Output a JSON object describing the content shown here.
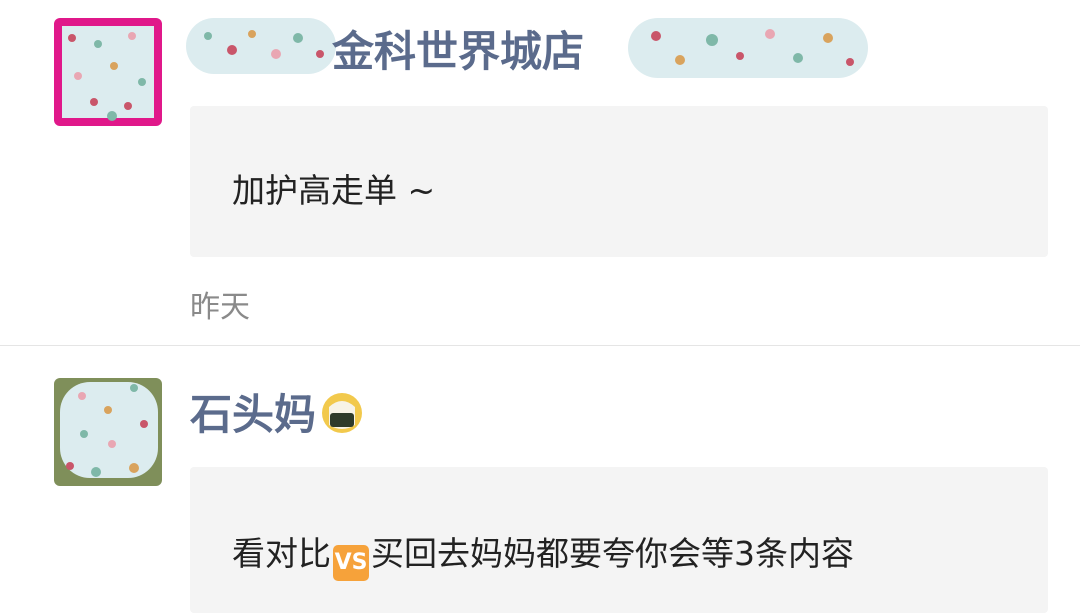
{
  "comments": [
    {
      "name": "金科世界城店",
      "text": "加护高走单 ~",
      "time": "昨天"
    },
    {
      "name": "石头妈",
      "text_before": "看对比",
      "vs_label": "VS",
      "text_after": "买回去妈妈都要夸你会等3条内容"
    }
  ],
  "icons": {
    "vs": "vs-emoji-icon",
    "rice": "rice-ball-emoji-icon"
  },
  "colors": {
    "name": "#5b6b8c",
    "bubble": "#f4f4f4",
    "time": "#8a8a8a",
    "avatar1_border": "#e0188a",
    "vs": "#f6a23a"
  }
}
